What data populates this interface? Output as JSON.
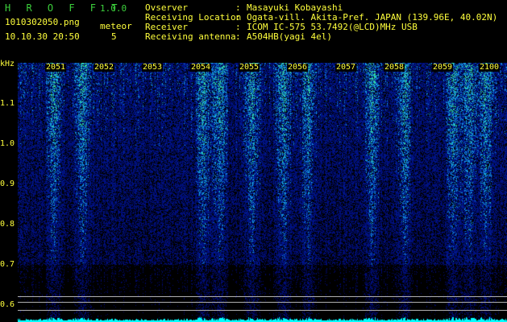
{
  "header": {
    "title": "H R O F F T",
    "version": "1.0.0",
    "filename": "1010302050.png",
    "datetime": "10.10.30 20:50",
    "meteor_label": "meteor",
    "meteor_count": "5",
    "fields": [
      {
        "label": "Ovserver",
        "value": "Masayuki Kobayashi"
      },
      {
        "label": "Receiving Location",
        "value": "Ogata-vill. Akita-Pref. JAPAN (139.96E, 40.02N)"
      },
      {
        "label": "Receiver",
        "value": "ICOM IC-575 53.7492(@LCD)MHz USB"
      },
      {
        "label": "Receiving antenna",
        "value": "A504HB(yagi 4el)"
      }
    ],
    "separator": ":"
  },
  "axis": {
    "y_unit": "kHz",
    "y_ticks": [
      "1.1",
      "1.0",
      "0.9",
      "0.8",
      "0.7",
      "0.6"
    ],
    "x_ticks": [
      "2051",
      "2052",
      "2053",
      "2054",
      "2055",
      "2056",
      "2057",
      "2058",
      "2059",
      "2100"
    ]
  },
  "colors": {
    "background": "#000000",
    "text_yellow": "#ffff3c",
    "text_green": "#3cd03c",
    "spectrum_low": "#00006e",
    "spectrum_mid": "#1e64ff",
    "spectrum_high": "#32ff96",
    "level_trace": "#00ffff",
    "guide_lines": "#b0b0b0"
  }
}
